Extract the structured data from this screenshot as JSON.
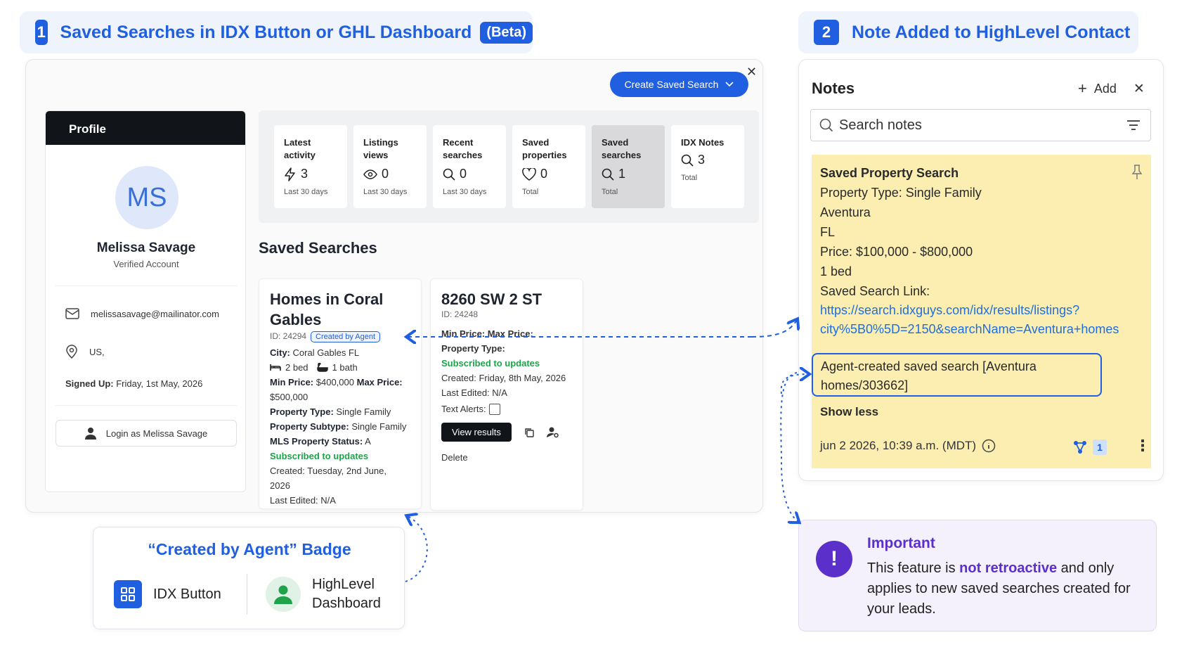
{
  "section1": {
    "number": "1",
    "title": "Saved Searches in IDX Button or GHL Dashboard",
    "beta": "(Beta)"
  },
  "section2": {
    "number": "2",
    "title": "Note Added to HighLevel Contact"
  },
  "toolbar": {
    "create_label": "Create Saved Search"
  },
  "profile": {
    "header": "Profile",
    "initials": "MS",
    "name": "Melissa Savage",
    "status": "Verified Account",
    "email": "melissasavage@mailinator.com",
    "location": "US,",
    "signed_up_label": "Signed Up:",
    "signed_up_value": "Friday, 1st May, 2026",
    "login_label": "Login as Melissa Savage"
  },
  "stats": [
    {
      "label1": "Latest",
      "label2": "activity",
      "icon": "bolt-icon",
      "value": "3",
      "sub": "Last 30 days"
    },
    {
      "label1": "Listings",
      "label2": "views",
      "icon": "eye-icon",
      "value": "0",
      "sub": "Last 30 days"
    },
    {
      "label1": "Recent",
      "label2": "searches",
      "icon": "search-icon",
      "value": "0",
      "sub": "Last 30 days"
    },
    {
      "label1": "Saved",
      "label2": "properties",
      "icon": "heart-icon",
      "value": "0",
      "sub": "Total"
    },
    {
      "label1": "Saved",
      "label2": "searches",
      "icon": "search-icon",
      "value": "1",
      "sub": "Total"
    },
    {
      "label1": "IDX Notes",
      "label2": "",
      "icon": "search-icon",
      "value": "3",
      "sub": "Total"
    }
  ],
  "saved_searches_title": "Saved Searches",
  "card1": {
    "title_line1": "Homes in Coral",
    "title_line2": "Gables",
    "id": "ID: 24294",
    "badge": "Created by Agent",
    "city_label": "City:",
    "city": "Coral Gables FL",
    "beds": "2 bed",
    "baths": "1 bath",
    "min_label": "Min Price:",
    "min_value": "$400,000",
    "max_label": "Max Price:",
    "max_value": "$500,000",
    "ptype_label": "Property Type:",
    "ptype": "Single Family",
    "psub_label": "Property Subtype:",
    "psub": "Single Family",
    "mls_label": "MLS Property Status:",
    "mls": "A",
    "subscribed": "Subscribed to updates",
    "created_line1": "Created: Tuesday, 2nd June,",
    "created_line2": "2026",
    "edited": "Last Edited: N/A"
  },
  "card2": {
    "title": "8260 SW 2 ST",
    "id": "ID: 24248",
    "price_line": "Min Price: Max Price:",
    "ptype_label": "Property Type:",
    "subscribed": "Subscribed to updates",
    "created": "Created: Friday, 8th May, 2026",
    "edited": "Last Edited: N/A",
    "alerts": "Text Alerts:",
    "view_label": "View results",
    "delete_label": "Delete"
  },
  "badge_box": {
    "title": "“Created by Agent” Badge",
    "idx_label": "IDX Button",
    "hl_line1": "HighLevel",
    "hl_line2": "Dashboard"
  },
  "notes": {
    "title": "Notes",
    "add_label": "Add",
    "search_placeholder": "Search notes",
    "note_title": "Saved Property Search",
    "lines": [
      "Property Type: Single Family",
      "Aventura",
      "FL",
      "Price: $100,000 - $800,000",
      "1 bed",
      "Saved Search Link:"
    ],
    "link_line1": "https://search.idxguys.com/idx/results/listings?",
    "link_line2": "city%5B0%5D=2150&searchName=Aventura+homes",
    "agent_line1": "Agent-created saved search [Aventura",
    "agent_line2": "homes/303662]",
    "show_less": "Show less",
    "timestamp": "jun 2 2026, 10:39 a.m. (MDT)",
    "count": "1"
  },
  "important": {
    "title": "Important",
    "text_before": "This feature is ",
    "text_bold": "not retroactive",
    "text_after": " and only applies to new saved searches created for your leads."
  },
  "colors": {
    "accent": "#1f5fe0",
    "note_bg": "#fbeeb0",
    "important": "#5b2fc9",
    "success": "#1fa34a"
  }
}
